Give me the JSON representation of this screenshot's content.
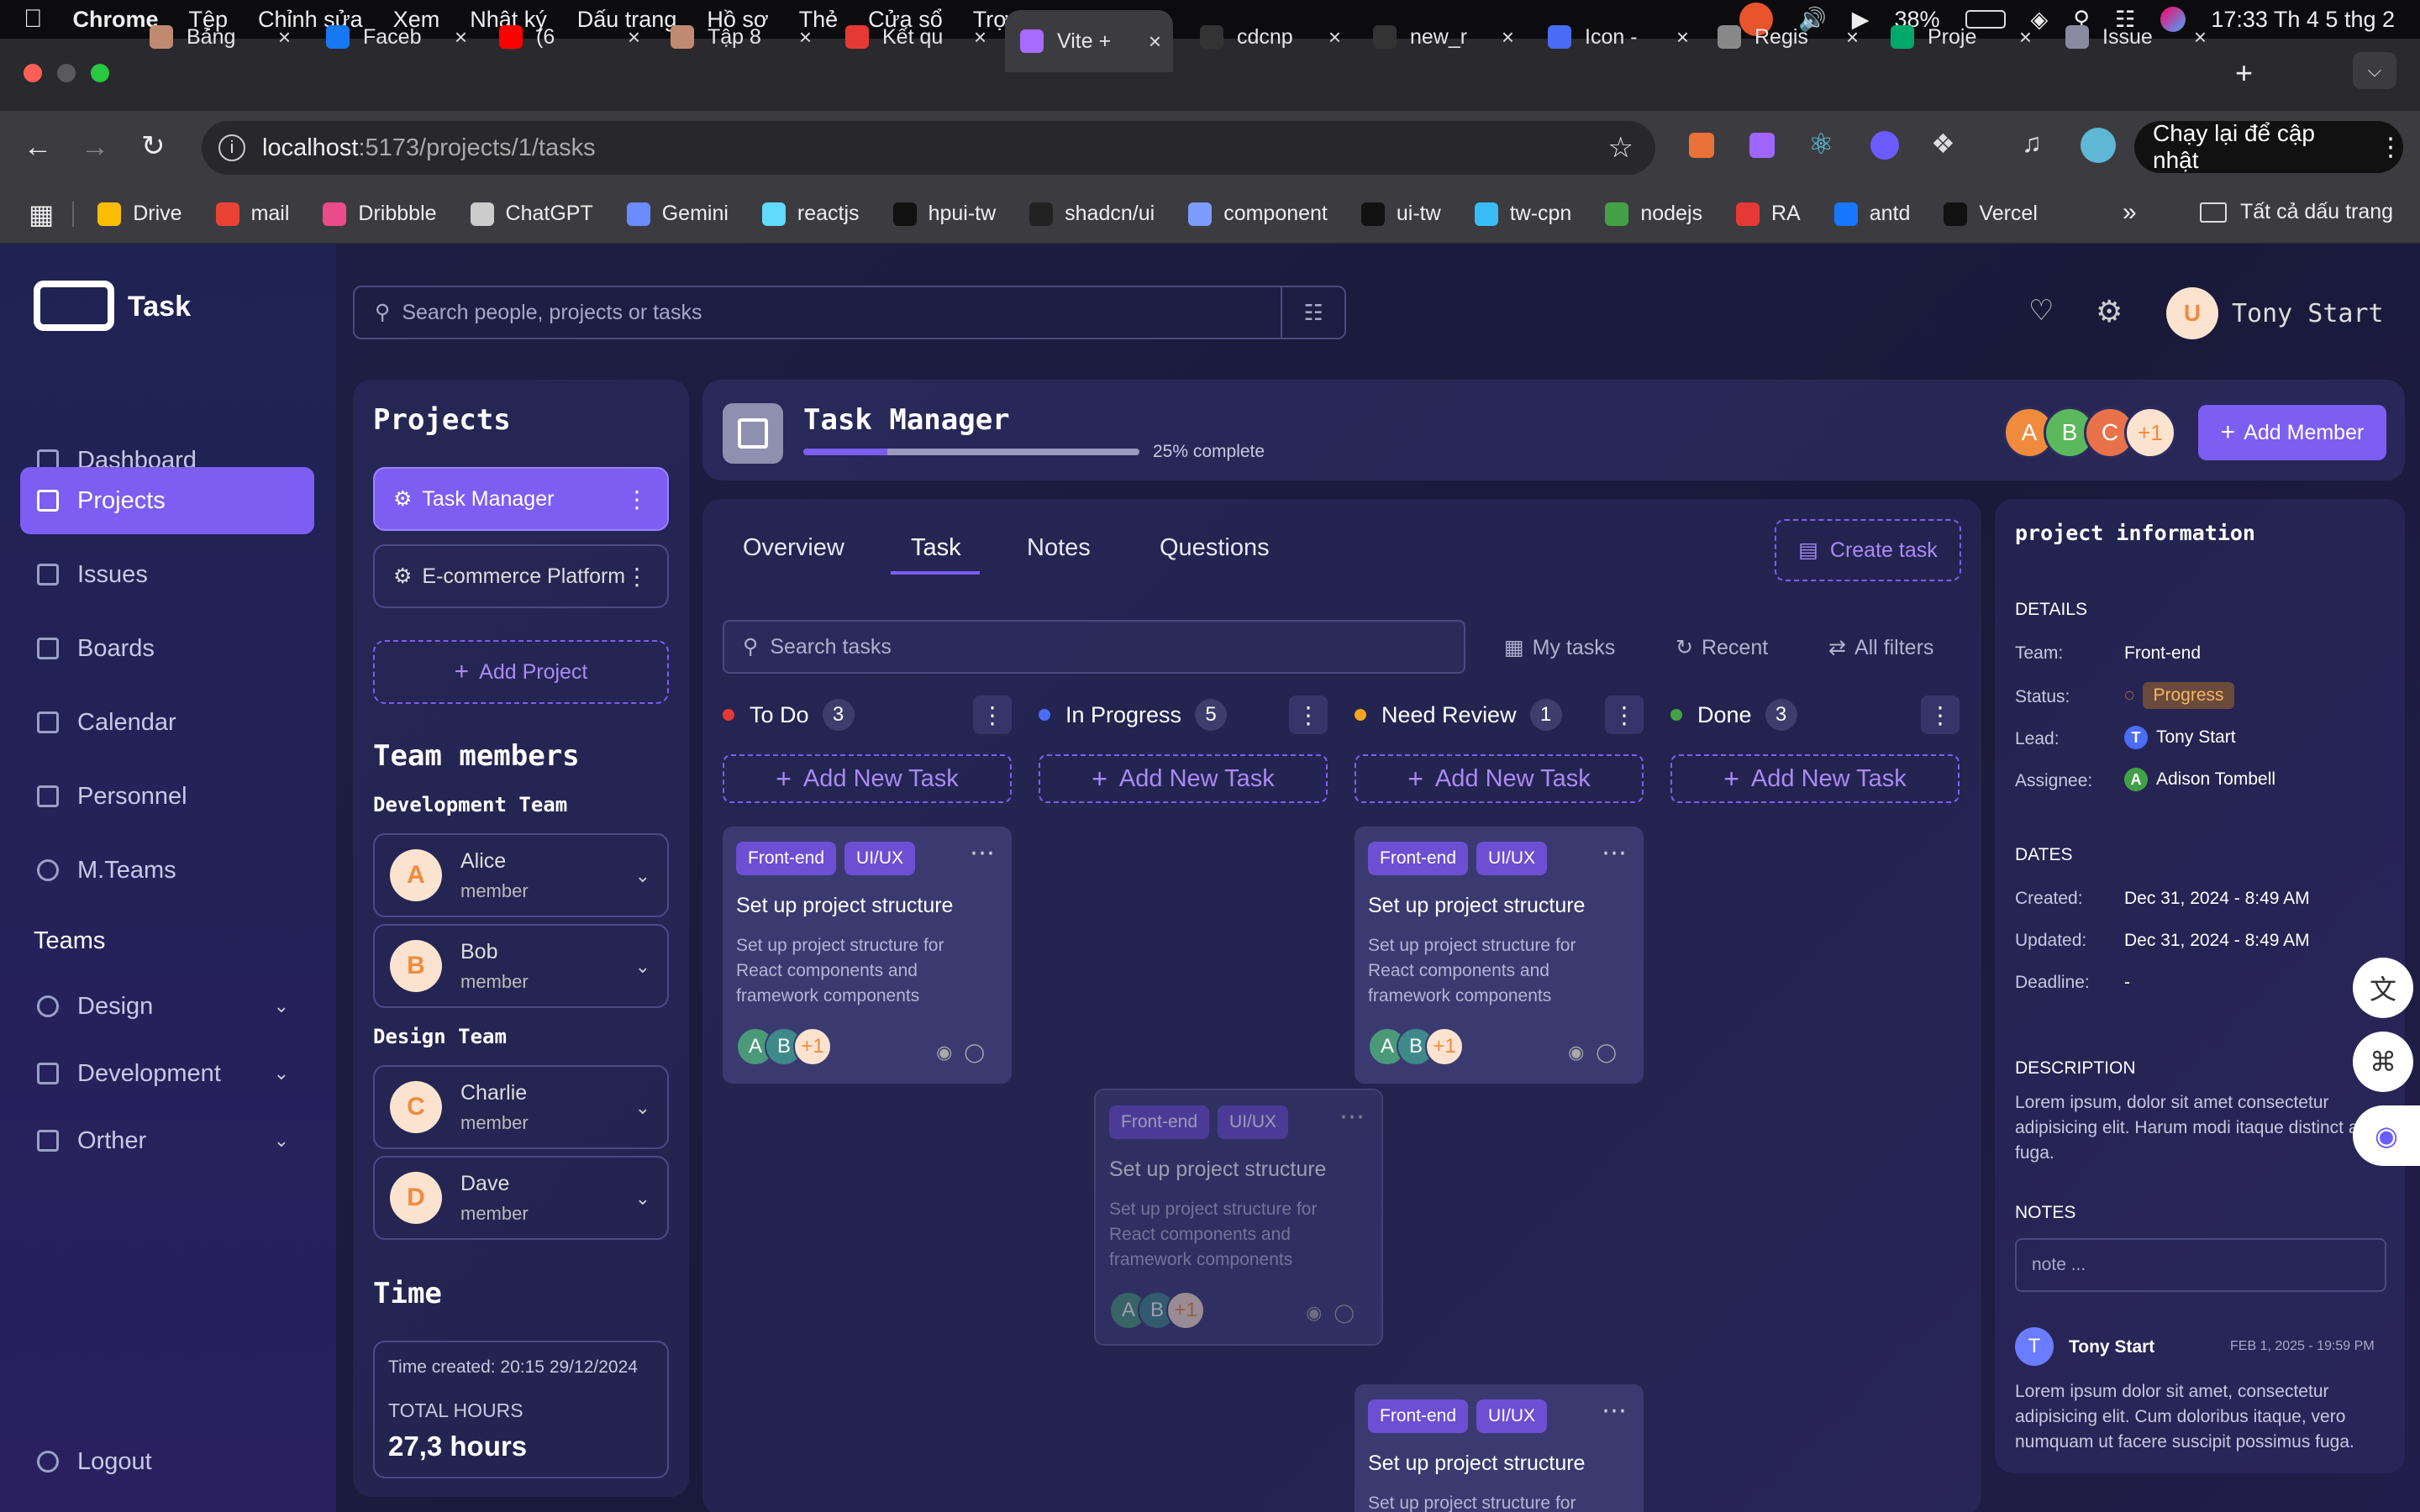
{
  "menubar": {
    "app": "Chrome",
    "items": [
      "Tệp",
      "Chỉnh sửa",
      "Xem",
      "Nhật ký",
      "Dấu trang",
      "Hồ sơ",
      "Thẻ",
      "Cửa sổ",
      "Trợ giúp"
    ],
    "battery": "38%",
    "clock": "17:33 Th 4 5 thg 2"
  },
  "tabs": [
    {
      "label": "Bảng",
      "color": "#c08a70"
    },
    {
      "label": "Faceb",
      "color": "#1877f2"
    },
    {
      "label": "(6",
      "color": "#ff0000"
    },
    {
      "label": "Tập 8",
      "color": "#c08a70"
    },
    {
      "label": "Kết qu",
      "color": "#e53935"
    },
    {
      "label": "Vite +",
      "color": "#a66bff"
    },
    {
      "label": "cdcnp",
      "color": "#333333"
    },
    {
      "label": "new_r",
      "color": "#333333"
    },
    {
      "label": "Icon -",
      "color": "#4a6cf7"
    },
    {
      "label": "Regis",
      "color": "#888888"
    },
    {
      "label": "Proje",
      "color": "#00a86b"
    },
    {
      "label": "Issue",
      "color": "#8a8aa0"
    }
  ],
  "address": {
    "host": "localhost",
    "path": ":5173/projects/1/tasks",
    "update_label": "Chạy lại để cập nhật"
  },
  "bookmarks": [
    {
      "label": "Drive",
      "color": "#fbbc04"
    },
    {
      "label": "mail",
      "color": "#ea4335"
    },
    {
      "label": "Dribbble",
      "color": "#ea4c89"
    },
    {
      "label": "ChatGPT",
      "color": "#cccccc"
    },
    {
      "label": "Gemini",
      "color": "#6a8cff"
    },
    {
      "label": "reactjs",
      "color": "#61dafb"
    },
    {
      "label": "hpui-tw",
      "color": "#111111"
    },
    {
      "label": "shadcn/ui",
      "color": "#222222"
    },
    {
      "label": "component",
      "color": "#7c9cff"
    },
    {
      "label": "ui-tw",
      "color": "#111111"
    },
    {
      "label": "tw-cpn",
      "color": "#38bdf8"
    },
    {
      "label": "nodejs",
      "color": "#43a047"
    },
    {
      "label": "RA",
      "color": "#e53935"
    },
    {
      "label": "antd",
      "color": "#1677ff"
    },
    {
      "label": "Vercel",
      "color": "#111111"
    }
  ],
  "bookmarks_all": "Tất cả dấu trang",
  "brand": "Task",
  "search": {
    "placeholder": "Search people, projects or tasks"
  },
  "user": {
    "initial": "U",
    "name": "Tony Start"
  },
  "nav": [
    "Dashboard",
    "Projects",
    "Issues",
    "Boards",
    "Calendar",
    "Personnel",
    "M.Teams"
  ],
  "teams_heading": "Teams",
  "teams": [
    "Design",
    "Development",
    "Orther"
  ],
  "logout": "Logout",
  "projects_panel": {
    "title": "Projects",
    "items": [
      "Task Manager",
      "E-commerce Platform"
    ],
    "add": "Add Project",
    "members_title": "Team members",
    "groups": [
      {
        "name": "Development Team",
        "members": [
          {
            "initial": "A",
            "name": "Alice",
            "role": "member"
          },
          {
            "initial": "B",
            "name": "Bob",
            "role": "member"
          }
        ]
      },
      {
        "name": "Design Team",
        "members": [
          {
            "initial": "C",
            "name": "Charlie",
            "role": "member"
          },
          {
            "initial": "D",
            "name": "Dave",
            "role": "member"
          }
        ]
      }
    ],
    "time_title": "Time",
    "time_created": "Time created: 20:15 29/12/2024",
    "total_hours_label": "TOTAL HOURS",
    "total_hours": "27,3 hours"
  },
  "project": {
    "name": "Task Manager",
    "progress": 0.25,
    "progress_label": "25% complete",
    "member_avatars": [
      "A",
      "B",
      "C",
      "+1"
    ],
    "add_member": "Add Member"
  },
  "tabs_nav": [
    "Overview",
    "Task",
    "Notes",
    "Questions"
  ],
  "create_task": "Create task",
  "task_search": {
    "placeholder": "Search tasks"
  },
  "filters": [
    "My tasks",
    "Recent",
    "All filters"
  ],
  "columns": [
    {
      "name": "To Do",
      "count": "3",
      "color": "#e53935"
    },
    {
      "name": "In Progress",
      "count": "5",
      "color": "#4a6cf7"
    },
    {
      "name": "Need Review",
      "count": "1",
      "color": "#f5a623"
    },
    {
      "name": "Done",
      "count": "3",
      "color": "#43a047"
    }
  ],
  "add_new_task": "Add New Task",
  "card": {
    "tags": [
      "Front-end",
      "UI/UX"
    ],
    "title": "Set up project structure",
    "desc": "Set up project structure for React components and framework components",
    "avatars": [
      "A",
      "B",
      "+1"
    ]
  },
  "info": {
    "title": "project information",
    "details_label": "DETAILS",
    "team_label": "Team:",
    "team": "Front-end",
    "status_label": "Status:",
    "status": "Progress",
    "lead_label": "Lead:",
    "lead": "Tony Start",
    "lead_initial": "T",
    "assignee_label": "Assignee:",
    "assignee": "Adison Tombell",
    "assignee_initial": "A",
    "dates_label": "DATES",
    "created_label": "Created:",
    "created": "Dec 31, 2024 - 8:49 AM",
    "updated_label": "Updated:",
    "updated": "Dec 31, 2024 - 8:49 AM",
    "deadline_label": "Deadline:",
    "deadline": "-",
    "description_label": "DESCRIPTION",
    "description": "Lorem ipsum, dolor sit amet consectetur adipisicing elit. Harum modi itaque distinct aut fuga.",
    "notes_label": "NOTES",
    "note_placeholder": "note ...",
    "comment": {
      "initial": "T",
      "author": "Tony Start",
      "date": "FEB 1, 2025 - 19:59 PM",
      "text": "Lorem ipsum dolor sit amet, consectetur adipisicing elit. Cum doloribus itaque, vero numquam ut facere suscipit possimus fuga."
    }
  }
}
